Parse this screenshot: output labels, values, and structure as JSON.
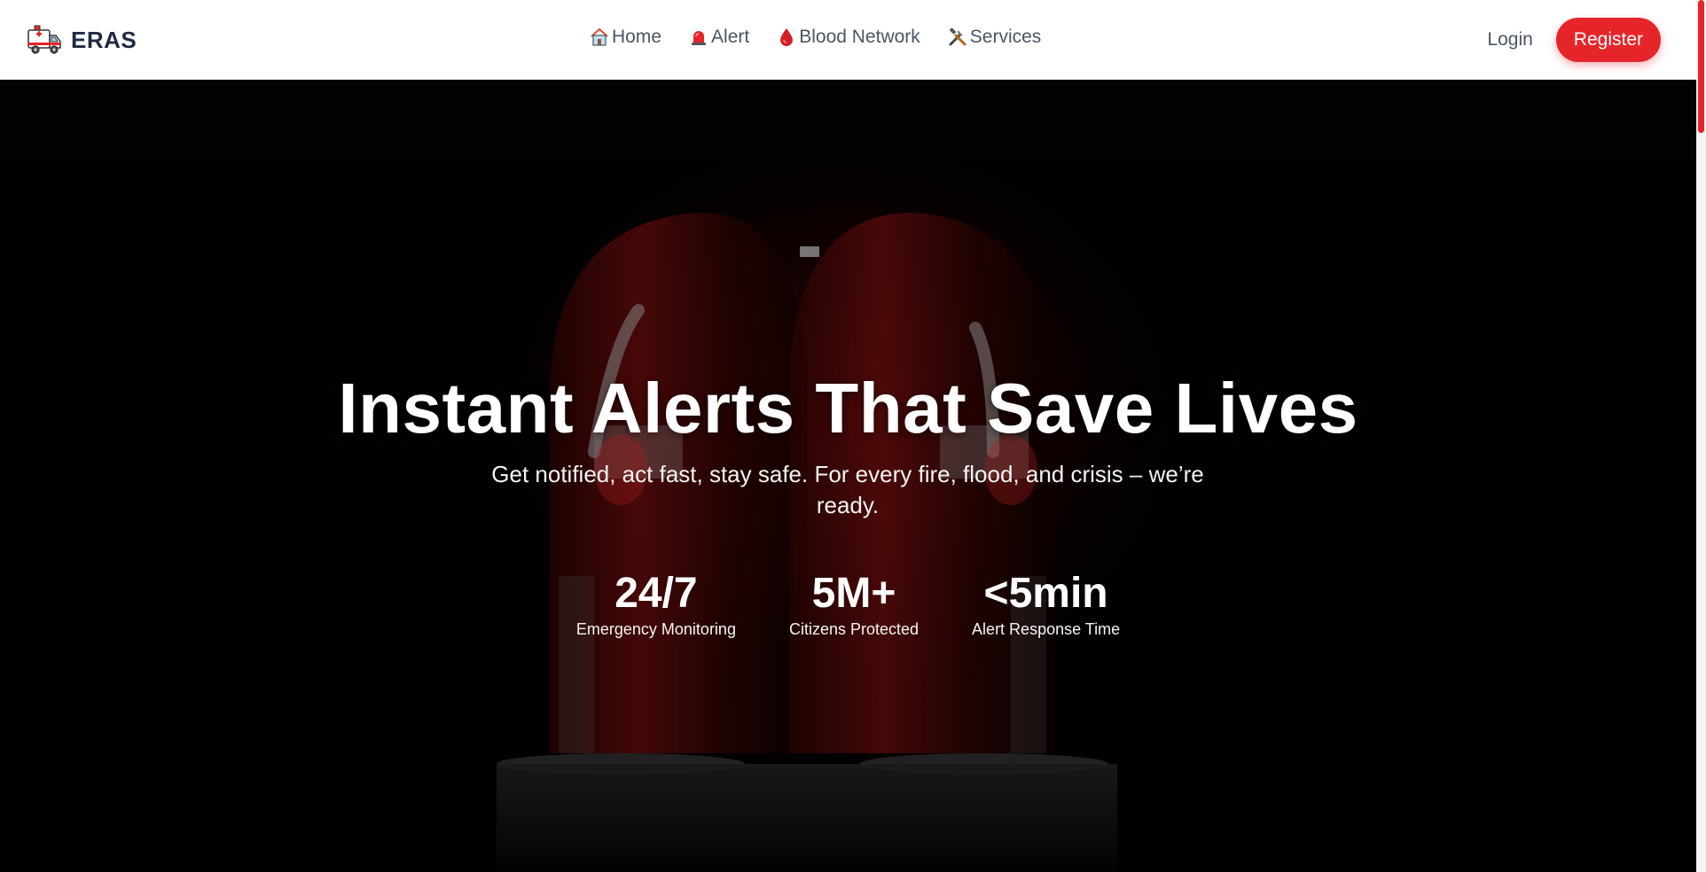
{
  "brand": {
    "name": "ERAS",
    "logo_icon": "ambulance-icon"
  },
  "nav": {
    "links": [
      {
        "label": "Home",
        "icon": "home-icon"
      },
      {
        "label": "Alert",
        "icon": "siren-icon"
      },
      {
        "label": "Blood Network",
        "icon": "blood-drop-icon"
      },
      {
        "label": "Services",
        "icon": "tools-icon"
      }
    ],
    "login_label": "Login",
    "register_label": "Register"
  },
  "hero": {
    "title": "Instant Alerts That Save Lives",
    "subtitle": "Get notified, act fast, stay safe. For every fire, flood, and crisis – we’re ready.",
    "stats": [
      {
        "value": "24/7",
        "label": "Emergency Monitoring"
      },
      {
        "value": "5M+",
        "label": "Citizens Protected"
      },
      {
        "value": "<5min",
        "label": "Alert Response Time"
      }
    ]
  },
  "colors": {
    "accent": "#e5252a",
    "nav_text": "#4b5563",
    "brand_text": "#1f2a44",
    "hero_bg": "#030303"
  }
}
